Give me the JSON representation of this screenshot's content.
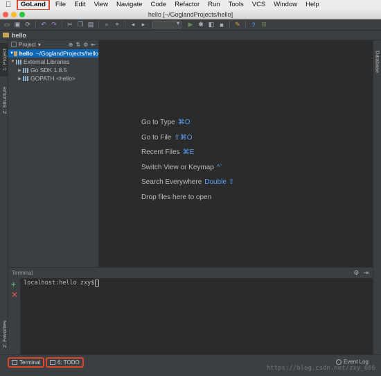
{
  "menubar": {
    "app_name": "GoLand",
    "items": [
      "File",
      "Edit",
      "View",
      "Navigate",
      "Code",
      "Refactor",
      "Run",
      "Tools",
      "VCS",
      "Window",
      "Help"
    ]
  },
  "window": {
    "title": "hello [~/GoglandProjects/hello]"
  },
  "navbar": {
    "crumb": "hello"
  },
  "left_stripe": {
    "tab_project": "1: Project",
    "tab_structure": "Z: Structure",
    "tab_favorites": "2: Favorites"
  },
  "right_stripe": {
    "tab_database": "Database"
  },
  "project_panel": {
    "header": "Project",
    "tree": [
      {
        "name": "hello",
        "path": "~/GoglandProjects/hello"
      },
      {
        "name": "External Libraries"
      },
      {
        "name": "Go SDK 1.8.5"
      },
      {
        "name": "GOPATH <hello>"
      }
    ]
  },
  "editor": {
    "hints": [
      {
        "label": "Go to Type",
        "key": "⌘O"
      },
      {
        "label": "Go to File",
        "key": "⇧⌘O"
      },
      {
        "label": "Recent Files",
        "key": "⌘E"
      },
      {
        "label": "Switch View or Keymap",
        "key": "^`"
      },
      {
        "label": "Search Everywhere",
        "key": "Double ⇧"
      },
      {
        "label": "Drop files here to open",
        "key": ""
      }
    ]
  },
  "terminal": {
    "title": "Terminal",
    "prompt": "localhost:hello zxy$"
  },
  "bottom": {
    "tab_terminal": "Terminal",
    "tab_todo": "6: TODO",
    "event_log": "Event Log",
    "watermark": "https://blog.csdn.net/zxy_666"
  },
  "colors": {
    "accent": "#0d66b3",
    "highlight_border": "#e0452b",
    "shortcut": "#589df6"
  }
}
